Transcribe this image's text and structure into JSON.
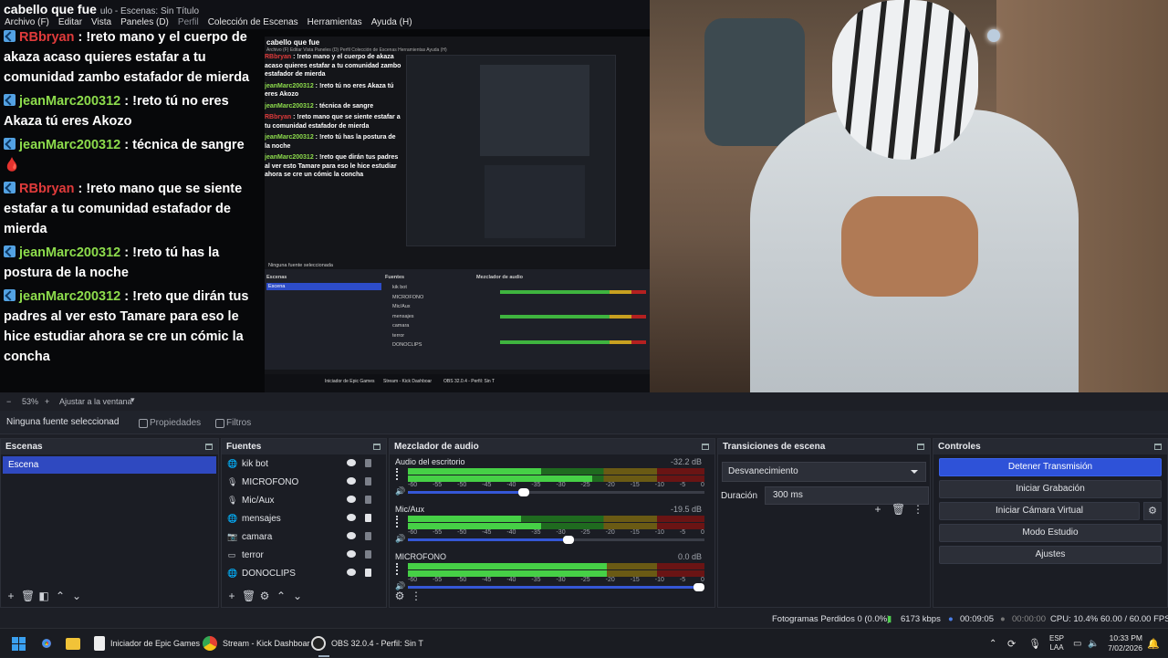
{
  "preview": {
    "overlay_title": "cabello que fue",
    "overlay_title_suffix": "ulo - Escenas: Sin Título",
    "menu": [
      "Archivo (F)",
      "Editar",
      "Vista",
      "Paneles (D)",
      "Perfil",
      "Colección de Escenas",
      "Herramientas",
      "Ayuda (H)"
    ],
    "chat": [
      {
        "user": "RBbryan",
        "color": "red",
        "text": ": !reto mano y el cuerpo de akaza acaso quieres estafar a tu comunidad zambo estafador de mierda"
      },
      {
        "user": "jeanMarc200312",
        "color": "green",
        "text": ": !reto tú no eres Akaza tú eres Akozo"
      },
      {
        "user": "jeanMarc200312",
        "color": "green",
        "text": ": técnica de sangre",
        "drop": "🩸"
      },
      {
        "user": "RBbryan",
        "color": "red",
        "text": ": !reto mano que se siente estafar a tu comunidad estafador de mierda"
      },
      {
        "user": "jeanMarc200312",
        "color": "green",
        "text": ": !reto tú has la postura de la noche"
      },
      {
        "user": "jeanMarc200312",
        "color": "green",
        "text": ": !reto que dirán tus padres al ver esto Tamare para eso le hice estudiar ahora se cre un cómic la concha"
      }
    ],
    "nested": {
      "title": "cabello que fue",
      "menu": "Archivo (F)  Editar  Vista  Paneles (D)  Perfil  Colección de Escenas  Herramientas  Ayuda (H)",
      "no_source": "Ninguna fuente seleccionada",
      "scenes_hd": "Escenas",
      "scene": "Escena",
      "sources_hd": "Fuentes",
      "sources": [
        "kik bot",
        "MICROFONO",
        "Mic/Aux",
        "mensajes",
        "camara",
        "terror",
        "DONOCLIPS"
      ],
      "mixer_hd": "Mezclador de audio",
      "task": [
        "Iniciador de Epic Games",
        "Stream - Kick Dashboar",
        "OBS 32.0.4 - Perfil: Sin T"
      ]
    }
  },
  "zoom": {
    "minus": "−",
    "value": "53%",
    "plus": "+",
    "fit": "Ajustar a la ventana"
  },
  "propbar": {
    "no_source": "Ninguna fuente seleccionad",
    "properties": "Propiedades",
    "filters": "Filtros"
  },
  "scenes": {
    "title": "Escenas",
    "items": [
      "Escena"
    ]
  },
  "sources": {
    "title": "Fuentes",
    "items": [
      {
        "name": "kik bot",
        "icon": "globe-icon",
        "locked": false
      },
      {
        "name": "MICROFONO",
        "icon": "mic-icon",
        "locked": false
      },
      {
        "name": "Mic/Aux",
        "icon": "mic-icon",
        "locked": false
      },
      {
        "name": "mensajes",
        "icon": "globe-icon",
        "locked": true
      },
      {
        "name": "camara",
        "icon": "camera-icon",
        "locked": false
      },
      {
        "name": "terror",
        "icon": "display-icon",
        "locked": false
      },
      {
        "name": "DONOCLIPS",
        "icon": "globe-icon",
        "locked": true
      }
    ]
  },
  "mixer": {
    "title": "Mezclador de audio",
    "ticks": [
      "-60",
      "-55",
      "-50",
      "-45",
      "-40",
      "-35",
      "-30",
      "-25",
      "-20",
      "-15",
      "-10",
      "-5",
      "0"
    ],
    "channels": [
      {
        "name": "Audio del escritorio",
        "db": "-32.2 dB",
        "level1": 0.45,
        "level2": 0.62,
        "volume": 0.39
      },
      {
        "name": "Mic/Aux",
        "db": "-19.5 dB",
        "level1": 0.38,
        "level2": 0.45,
        "volume": 0.54
      },
      {
        "name": "MICROFONO",
        "db": "0.0 dB",
        "level1": 0.67,
        "level2": 0.67,
        "volume": 0.98
      }
    ]
  },
  "transitions": {
    "title": "Transiciones de escena",
    "selected": "Desvanecimiento",
    "duration_label": "Duración",
    "duration": "300 ms"
  },
  "controls": {
    "title": "Controles",
    "stop_stream": "Detener Transmisión",
    "start_recording": "Iniciar Grabación",
    "virtual_cam": "Iniciar Cámara Virtual",
    "studio": "Modo Estudio",
    "settings": "Ajustes"
  },
  "status": {
    "dropped": "Fotogramas Perdidos 0 (0.0%)",
    "bitrate": "6173 kbps",
    "stream_time": "00:09:05",
    "rec_time": "00:00:00",
    "cpu": "CPU: 10.4%",
    "fps": "60.00 / 60.00 FPS"
  },
  "taskbar": {
    "epic": "Iniciador de Epic Games",
    "kick": "Stream - Kick Dashboar",
    "obs": "OBS 32.0.4 - Perfil: Sin T",
    "lang1": "ESP",
    "lang2": "LAA",
    "time": "10:33 PM",
    "date": "7/02/2026"
  }
}
